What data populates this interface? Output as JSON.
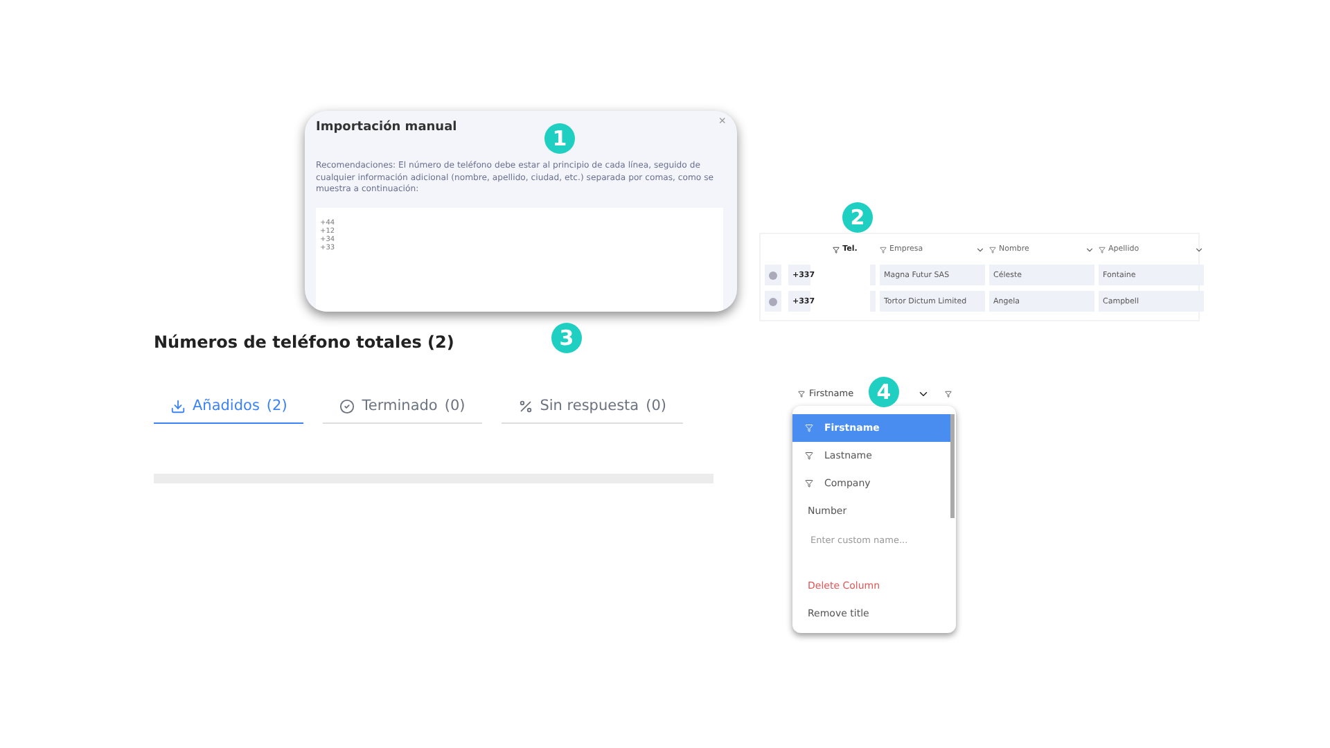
{
  "import_dialog": {
    "title": "Importación manual",
    "close": "×",
    "recommendation": "Recomendaciones: El número de teléfono debe estar al principio de cada línea, seguido de cualquier información adicional (nombre, apellido, ciudad, etc.) separada por comas, como se muestra a continuación:",
    "example_lines": [
      "+44",
      "+12",
      "+34",
      "+33"
    ]
  },
  "contacts_table": {
    "columns": [
      "Tel.",
      "Empresa",
      "Nombre",
      "Apellido"
    ],
    "rows": [
      [
        "+337",
        "Magna Futur SAS",
        "Céleste",
        "Fontaine"
      ],
      [
        "+337",
        "Tortor Dictum Limited",
        "Angela",
        "Campbell"
      ]
    ]
  },
  "phone_summary": {
    "title": "Números de teléfono totales (2)",
    "tabs": [
      {
        "label": "Añadidos",
        "count": "(2)",
        "selected": true
      },
      {
        "label": "Terminado",
        "count": "(0)",
        "selected": false
      },
      {
        "label": "Sin respuesta",
        "count": "(0)",
        "selected": false
      }
    ]
  },
  "column_menu": {
    "header": "Firstname",
    "items": [
      {
        "kind": "field",
        "label": "Firstname",
        "selected": true
      },
      {
        "kind": "field",
        "label": "Lastname",
        "selected": false
      },
      {
        "kind": "field",
        "label": "Company",
        "selected": false
      },
      {
        "kind": "plain",
        "label": "Number",
        "selected": false
      },
      {
        "kind": "input",
        "placeholder": "Enter custom name..."
      },
      {
        "kind": "danger",
        "label": "Delete Column"
      },
      {
        "kind": "plain",
        "label": "Remove title",
        "selected": false
      }
    ]
  },
  "badges": [
    "1",
    "2",
    "3",
    "4"
  ]
}
